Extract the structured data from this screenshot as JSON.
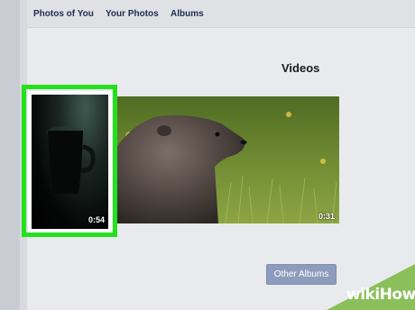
{
  "tabs": [
    {
      "label": "Photos of You"
    },
    {
      "label": "Your Photos"
    },
    {
      "label": "Albums"
    }
  ],
  "section_title": "Videos",
  "videos": [
    {
      "duration": "0:54",
      "highlighted": true
    },
    {
      "duration": "0:31",
      "highlighted": false
    }
  ],
  "other_albums_label": "Other Albums",
  "watermark": {
    "text": "wikiHow"
  },
  "colors": {
    "highlight": "#25e01f",
    "button": "#8d9cbc",
    "tab_text": "#1d2b4f",
    "watermark_bg": "#8bbf5b"
  }
}
